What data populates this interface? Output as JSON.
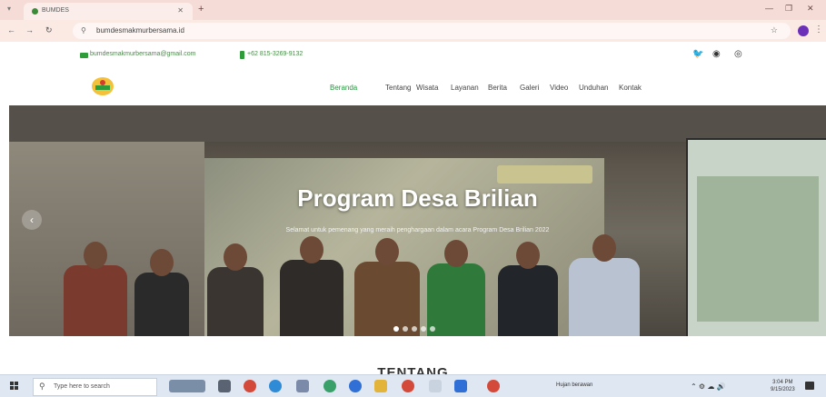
{
  "browser": {
    "tab_title": "BUMDES",
    "url": "bumdesmakmurbersama.id"
  },
  "contact": {
    "email": "bumdesmakmurbersama@gmail.com",
    "phone": "+62 815-3269-9132"
  },
  "nav": {
    "items": [
      {
        "label": "Beranda",
        "active": true
      },
      {
        "label": "Tentang",
        "active": false
      },
      {
        "label": "Wisata",
        "active": false
      },
      {
        "label": "Layanan",
        "active": false
      },
      {
        "label": "Berita",
        "active": false
      },
      {
        "label": "Galeri",
        "active": false
      },
      {
        "label": "Video",
        "active": false
      },
      {
        "label": "Unduhan",
        "active": false
      },
      {
        "label": "Kontak",
        "active": false
      }
    ]
  },
  "hero": {
    "title": "Program Desa Brilian",
    "subtitle": "Selamat untuk pemenang yang meraih penghargaan dalam acara Program Desa Brilian 2022",
    "slide_count": 5,
    "active_slide": 1
  },
  "section": {
    "title": "TENTANG"
  },
  "taskbar": {
    "search_placeholder": "Type here to search",
    "tray_status": "Hujan berawan",
    "clock_time": "3:04 PM",
    "clock_date": "9/15/2023"
  },
  "colors": {
    "brand_green": "#1f9a3a",
    "tab_strip": "#f6dcd6"
  }
}
